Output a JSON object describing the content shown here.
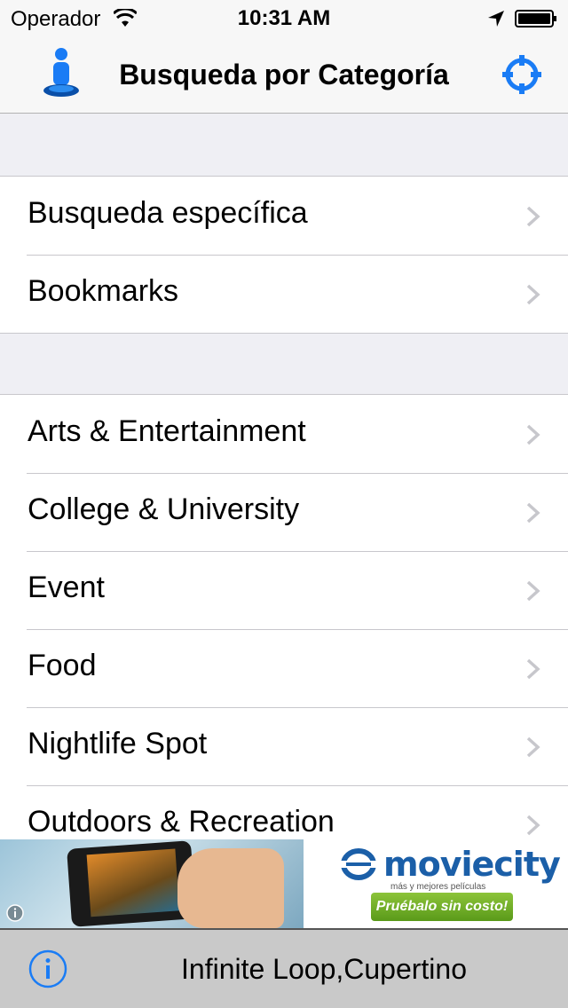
{
  "status_bar": {
    "carrier": "Operador",
    "time": "10:31 AM"
  },
  "nav_bar": {
    "title": "Busqueda por Categoría",
    "left_icon": "person-pin-icon",
    "right_icon": "crosshair-icon"
  },
  "groups": [
    {
      "items": [
        {
          "label": "Busqueda específica"
        },
        {
          "label": "Bookmarks"
        }
      ]
    },
    {
      "items": [
        {
          "label": "Arts & Entertainment"
        },
        {
          "label": "College & University"
        },
        {
          "label": "Event"
        },
        {
          "label": "Food"
        },
        {
          "label": "Nightlife Spot"
        },
        {
          "label": "Outdoors & Recreation"
        }
      ]
    }
  ],
  "ad": {
    "brand": "moviecity",
    "tagline": "más y mejores películas",
    "cta": "Pruébalo sin costo!"
  },
  "toolbar": {
    "location": "Infinite Loop,Cupertino",
    "info_icon": "info-icon"
  },
  "colors": {
    "accent": "#1a7cf5",
    "chevron": "#c7c7cc",
    "separator": "#c8c7cc",
    "background": "#efeff4"
  }
}
